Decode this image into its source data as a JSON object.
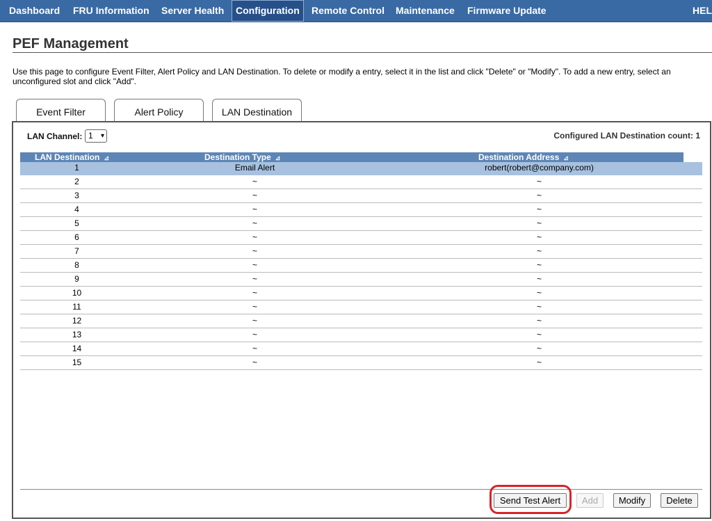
{
  "nav": {
    "dashboard": "Dashboard",
    "fru": "FRU Information",
    "health": "Server Health",
    "configuration": "Configuration",
    "remote": "Remote Control",
    "maintenance": "Maintenance",
    "firmware": "Firmware Update",
    "help": "HEL"
  },
  "page": {
    "title": "PEF Management",
    "description": "Use this page to configure Event Filter, Alert Policy and LAN Destination. To delete or modify a entry, select it in the list and click \"Delete\" or \"Modify\". To add a new entry, select an unconfigured slot and click \"Add\"."
  },
  "tabs": [
    "Event Filter",
    "Alert Policy",
    "LAN Destination"
  ],
  "lan_channel": {
    "label": "LAN Channel:",
    "value": "1"
  },
  "count_text": "Configured LAN Destination count: 1",
  "table": {
    "headers": [
      "LAN Destination",
      "Destination Type",
      "Destination Address"
    ],
    "rows": [
      [
        "1",
        "Email Alert",
        "robert(robert@company.com)"
      ],
      [
        "2",
        "~",
        "~"
      ],
      [
        "3",
        "~",
        "~"
      ],
      [
        "4",
        "~",
        "~"
      ],
      [
        "5",
        "~",
        "~"
      ],
      [
        "6",
        "~",
        "~"
      ],
      [
        "7",
        "~",
        "~"
      ],
      [
        "8",
        "~",
        "~"
      ],
      [
        "9",
        "~",
        "~"
      ],
      [
        "10",
        "~",
        "~"
      ],
      [
        "11",
        "~",
        "~"
      ],
      [
        "12",
        "~",
        "~"
      ],
      [
        "13",
        "~",
        "~"
      ],
      [
        "14",
        "~",
        "~"
      ],
      [
        "15",
        "~",
        "~"
      ]
    ]
  },
  "buttons": {
    "send_test": "Send Test Alert",
    "add": "Add",
    "modify": "Modify",
    "delete": "Delete"
  },
  "colors": {
    "nav_bg": "#3a6aa4",
    "header_bg": "#5d86b6",
    "selected_row": "#a7c1df",
    "highlight": "#d8232a"
  }
}
